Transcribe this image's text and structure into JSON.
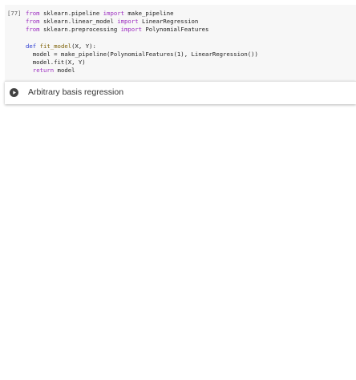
{
  "code_cell": {
    "execution_count": "[77]",
    "lines": [
      [
        {
          "t": "kw",
          "v": "from"
        },
        {
          "t": "plain",
          "v": " sklearn.pipeline "
        },
        {
          "t": "kw",
          "v": "import"
        },
        {
          "t": "plain",
          "v": " make_pipeline"
        }
      ],
      [
        {
          "t": "kw",
          "v": "from"
        },
        {
          "t": "plain",
          "v": " sklearn.linear_model "
        },
        {
          "t": "kw",
          "v": "import"
        },
        {
          "t": "plain",
          "v": " LinearRegression"
        }
      ],
      [
        {
          "t": "kw",
          "v": "from"
        },
        {
          "t": "plain",
          "v": " sklearn.preprocessing "
        },
        {
          "t": "kw",
          "v": "import"
        },
        {
          "t": "plain",
          "v": " PolynomialFeatures"
        }
      ],
      [],
      [
        {
          "t": "def",
          "v": "def"
        },
        {
          "t": "plain",
          "v": " "
        },
        {
          "t": "fn",
          "v": "fit_model"
        },
        {
          "t": "plain",
          "v": "(X, Y):"
        }
      ],
      [
        {
          "t": "plain",
          "v": "  model = make_pipeline(PolynomialFeatures(1), LinearRegression())"
        }
      ],
      [
        {
          "t": "plain",
          "v": "  model.fit(X, Y)"
        }
      ],
      [
        {
          "t": "plain",
          "v": "  "
        },
        {
          "t": "kw",
          "v": "return"
        },
        {
          "t": "plain",
          "v": " model"
        }
      ]
    ]
  },
  "text_cell": {
    "heading": "Arbitrary basis regression",
    "toggle_icon": "play-circle-icon"
  },
  "colors": {
    "keyword": "#9b2bbf",
    "def_keyword": "#2a3bd0",
    "function_name": "#7a5d00",
    "code_background": "#f7f7f7"
  }
}
